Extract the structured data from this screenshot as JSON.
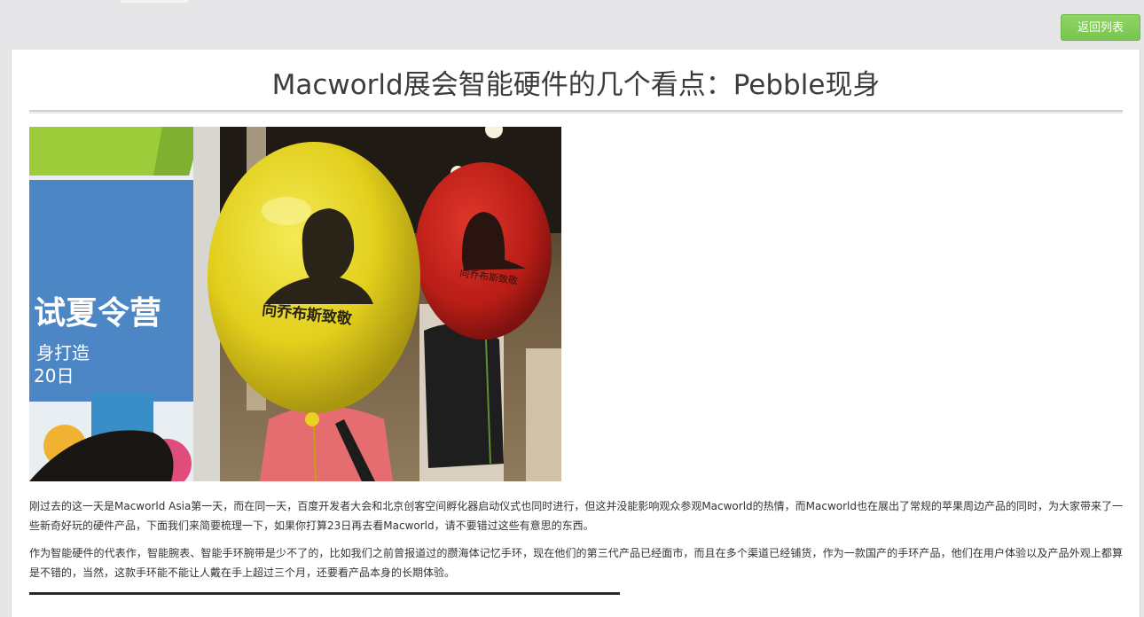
{
  "toolbar": {
    "back_label": "返回列表"
  },
  "article": {
    "title": "Macworld展会智能硬件的几个看点：Pebble现身",
    "image": {
      "balloon_text_yellow": "向乔布斯致敬",
      "balloon_text_red": "向乔布斯致敬",
      "poster_text_1": "试夏令营",
      "poster_text_2": "身打造",
      "poster_text_3": "20日"
    },
    "paragraphs": [
      "刚过去的这一天是Macworld Asia第一天，而在同一天，百度开发者大会和北京创客空间孵化器启动仪式也同时进行，但这并没能影响观众参观Macworld的热情，而Macworld也在展出了常规的苹果周边产品的同时，为大家带来了一些新奇好玩的硬件产品，下面我们来简要梳理一下，如果你打算23日再去看Macworld，请不要错过这些有意思的东西。",
      "作为智能硬件的代表作，智能腕表、智能手环腕带是少不了的，比如我们之前曾报道过的臜海体记忆手环，现在他们的第三代产品已经面市，而且在多个渠道已经铺货，作为一款国产的手环产品，他们在用户体验以及产品外观上都算是不错的，当然，这款手环能不能让人戴在手上超过三个月，还要看产品本身的长期体验。"
    ]
  },
  "colors": {
    "accent_green": "#7ccb52",
    "page_bg": "#e6e6e8",
    "card_bg": "#ffffff",
    "title_text": "#3c3c3c",
    "body_text": "#333333"
  }
}
